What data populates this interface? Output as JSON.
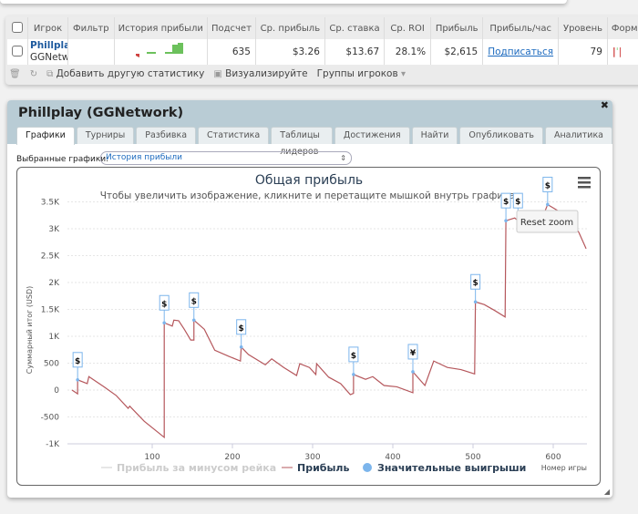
{
  "table": {
    "headers": [
      "Игрок",
      "Фильтр",
      "История прибыли",
      "Подсчет",
      "Ср. прибыль",
      "Ср. ставка",
      "Ср. ROI",
      "Прибыль",
      "Прибыль/час",
      "Уровень",
      "Форм"
    ],
    "row": {
      "player": "Phillplay",
      "network": "GGNetwo",
      "filter": "",
      "count": "635",
      "avg_profit": "$3.26",
      "avg_stake": "$13.67",
      "avg_roi": "28.1%",
      "profit": "$2,615",
      "profit_per_hour": "Подписаться",
      "level": "79"
    },
    "toolbar": {
      "add_stat": "Добавить другую статистику",
      "visualize": "Визуализируйте",
      "player_groups": "Группы игроков"
    }
  },
  "widget": {
    "title": "Phillplay (GGNetwork)",
    "tabs": [
      "Графики",
      "Турниры",
      "Разбивка",
      "Статистика",
      "Таблицы лидеров",
      "Достижения",
      "Найти",
      "Опубликовать",
      "Аналитика"
    ],
    "active_tab": "Графики",
    "selected_label": "Выбранные графики:",
    "selected_value": "История прибыли",
    "reset_zoom": "Reset zoom"
  },
  "chart_data": {
    "type": "line",
    "title": "Общая прибыль",
    "subtitle": "Чтобы увеличить изображение, кликните и перетащите мышкой внутрь графика.",
    "ylabel": "Суммарный итог (USD)",
    "xlabel": "Номер игры",
    "ylim": [
      -1000,
      3500
    ],
    "xlim": [
      0,
      640
    ],
    "yticks": [
      "3.5K",
      "3K",
      "2.5K",
      "2K",
      "1.5K",
      "1K",
      "500",
      "0",
      "-500",
      "-1K"
    ],
    "ytick_values": [
      3500,
      3000,
      2500,
      2000,
      1500,
      1000,
      500,
      0,
      -500,
      -1000
    ],
    "xticks": [
      100,
      200,
      300,
      400,
      500,
      600
    ],
    "grid": true,
    "legend_placement": "bottom",
    "legend": [
      {
        "name": "Прибыль за минусом рейка",
        "color": "#cccccc",
        "hidden": true
      },
      {
        "name": "Прибыль",
        "color": "#b5575c"
      },
      {
        "name": "Значительные выигрыши",
        "color": "#7cb5ec"
      }
    ],
    "series": [
      {
        "name": "Прибыль",
        "color": "#b5575c",
        "points": [
          [
            0,
            0
          ],
          [
            7,
            -70
          ],
          [
            7,
            190
          ],
          [
            19,
            120
          ],
          [
            21,
            250
          ],
          [
            40,
            60
          ],
          [
            55,
            -100
          ],
          [
            70,
            -340
          ],
          [
            72,
            -300
          ],
          [
            90,
            -580
          ],
          [
            105,
            -760
          ],
          [
            115,
            -880
          ],
          [
            115,
            1250
          ],
          [
            125,
            1190
          ],
          [
            127,
            1300
          ],
          [
            133,
            1290
          ],
          [
            140,
            1130
          ],
          [
            148,
            930
          ],
          [
            152,
            930
          ],
          [
            152,
            1300
          ],
          [
            165,
            1130
          ],
          [
            178,
            740
          ],
          [
            195,
            630
          ],
          [
            210,
            540
          ],
          [
            211,
            800
          ],
          [
            220,
            660
          ],
          [
            241,
            470
          ],
          [
            249,
            580
          ],
          [
            264,
            420
          ],
          [
            280,
            270
          ],
          [
            284,
            490
          ],
          [
            296,
            420
          ],
          [
            304,
            290
          ],
          [
            305,
            490
          ],
          [
            320,
            240
          ],
          [
            335,
            120
          ],
          [
            347,
            -85
          ],
          [
            351,
            -60
          ],
          [
            351,
            290
          ],
          [
            366,
            200
          ],
          [
            375,
            250
          ],
          [
            389,
            85
          ],
          [
            405,
            60
          ],
          [
            425,
            -50
          ],
          [
            425,
            340
          ],
          [
            440,
            85
          ],
          [
            451,
            540
          ],
          [
            468,
            420
          ],
          [
            485,
            380
          ],
          [
            502,
            300
          ],
          [
            503,
            1640
          ],
          [
            514,
            1590
          ],
          [
            527,
            1480
          ],
          [
            540,
            1360
          ],
          [
            541,
            3150
          ],
          [
            552,
            3200
          ],
          [
            556,
            3150
          ],
          [
            570,
            3050
          ],
          [
            585,
            3150
          ],
          [
            593,
            3450
          ],
          [
            610,
            3300
          ],
          [
            625,
            3100
          ],
          [
            632,
            2930
          ],
          [
            641,
            2630
          ]
        ]
      }
    ],
    "big_wins": [
      {
        "x": 7,
        "y": 190,
        "label": "$"
      },
      {
        "x": 115,
        "y": 1250,
        "label": "$"
      },
      {
        "x": 152,
        "y": 1300,
        "label": "$"
      },
      {
        "x": 211,
        "y": 800,
        "label": "$"
      },
      {
        "x": 351,
        "y": 290,
        "label": "$"
      },
      {
        "x": 425,
        "y": 340,
        "label": "¥"
      },
      {
        "x": 503,
        "y": 1640,
        "label": "$"
      },
      {
        "x": 541,
        "y": 3150,
        "label": "$"
      },
      {
        "x": 556,
        "y": 3150,
        "label": "$"
      },
      {
        "x": 593,
        "y": 3450,
        "label": "$"
      }
    ]
  }
}
